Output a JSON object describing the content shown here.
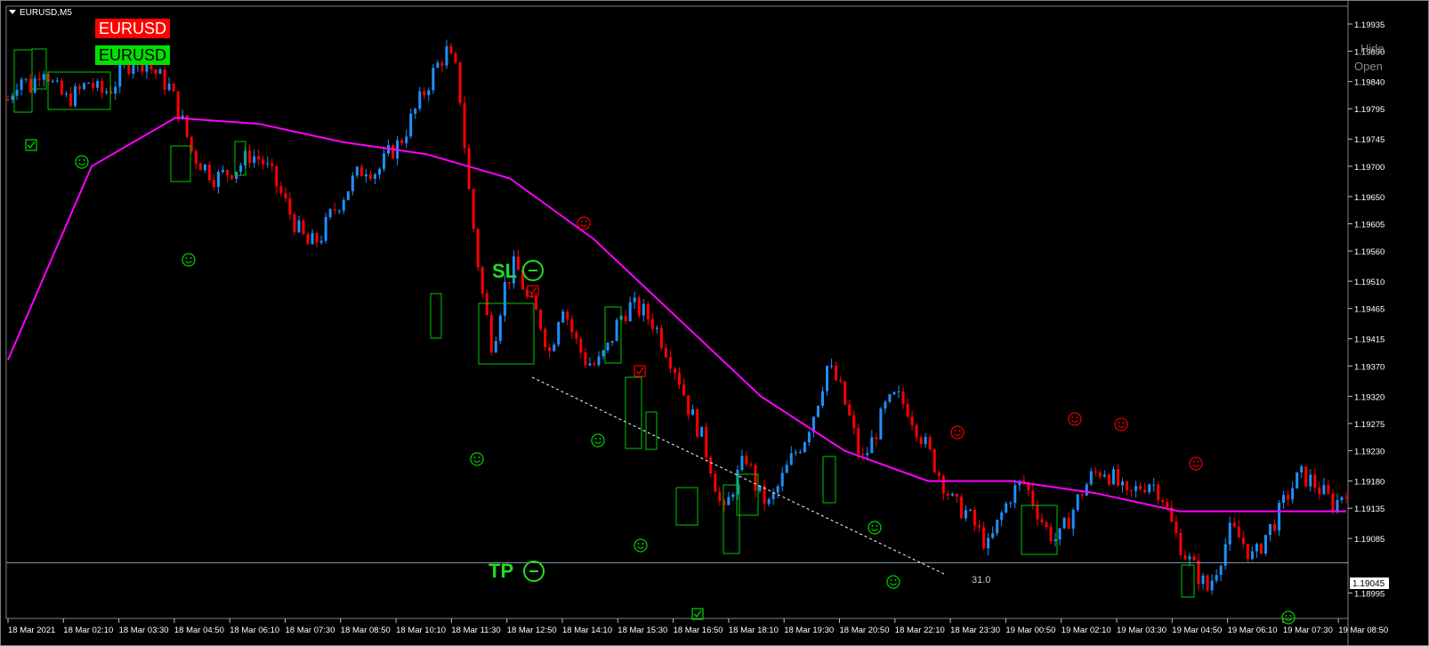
{
  "window": {
    "symbol_tf": "EURUSD,M5"
  },
  "overlay": {
    "tag_red": "EURUSD",
    "tag_green": "EURUSD",
    "hide": "Hide",
    "open": "Open",
    "sl_label": "SL",
    "tp_label": "TP",
    "measure": "31.0",
    "current_price": "1.19045",
    "colors": {
      "bull": "#1e90ff",
      "bear": "#ff0000",
      "ma": "#ff00ff",
      "box": "#00c800",
      "tag_red": "#ff0000",
      "tag_green": "#00e000",
      "smiley_good": "#00c800",
      "smiley_bad": "#e00000"
    }
  },
  "chart_data": {
    "type": "candlestick",
    "symbol": "EURUSD",
    "timeframe": "M5",
    "ylim": [
      1.18975,
      1.1996
    ],
    "y_ticks": [
      "1.19935",
      "1.19890",
      "1.19840",
      "1.19795",
      "1.19745",
      "1.19700",
      "1.19650",
      "1.19605",
      "1.19560",
      "1.19510",
      "1.19465",
      "1.19415",
      "1.19370",
      "1.19320",
      "1.19275",
      "1.19230",
      "1.19180",
      "1.19135",
      "1.19085",
      "1.19045",
      "1.18995"
    ],
    "x_ticks": [
      "18 Mar 2021",
      "18 Mar 02:10",
      "18 Mar 03:30",
      "18 Mar 04:50",
      "18 Mar 06:10",
      "18 Mar 07:30",
      "18 Mar 08:50",
      "18 Mar 10:10",
      "18 Mar 11:30",
      "18 Mar 12:50",
      "18 Mar 14:10",
      "18 Mar 15:30",
      "18 Mar 16:50",
      "18 Mar 18:10",
      "18 Mar 19:30",
      "18 Mar 20:50",
      "18 Mar 22:10",
      "18 Mar 23:30",
      "19 Mar 00:50",
      "19 Mar 02:10",
      "19 Mar 03:30",
      "19 Mar 04:50",
      "19 Mar 06:10",
      "19 Mar 07:30",
      "19 Mar 08:50"
    ],
    "close_path": [
      1.1981,
      1.1985,
      1.1983,
      1.1987,
      1.1983,
      1.1981,
      1.1982,
      1.1984,
      1.1982,
      1.1983,
      1.1986,
      1.1988,
      1.1987,
      1.1985,
      1.1983,
      1.1978,
      1.1972,
      1.197,
      1.1968,
      1.1969,
      1.197,
      1.1972,
      1.1971,
      1.1968,
      1.1964,
      1.196,
      1.1957,
      1.1958,
      1.1962,
      1.1965,
      1.1968,
      1.197,
      1.1969,
      1.1972,
      1.1974,
      1.1978,
      1.1982,
      1.1986,
      1.1989,
      1.1985,
      1.1965,
      1.195,
      1.194,
      1.195,
      1.1954,
      1.1948,
      1.1945,
      1.1939,
      1.1948,
      1.1942,
      1.1938,
      1.1937,
      1.194,
      1.1945,
      1.1947,
      1.1946,
      1.1944,
      1.194,
      1.1936,
      1.193,
      1.1926,
      1.192,
      1.1912,
      1.1918,
      1.1922,
      1.1916,
      1.1914,
      1.1918,
      1.1922,
      1.1925,
      1.193,
      1.1937,
      1.1934,
      1.1928,
      1.1921,
      1.1925,
      1.193,
      1.1932,
      1.193,
      1.1926,
      1.1922,
      1.1918,
      1.1914,
      1.1913,
      1.191,
      1.1907,
      1.1912,
      1.1916,
      1.1918,
      1.1914,
      1.191,
      1.1908,
      1.1912,
      1.1916,
      1.1919,
      1.192,
      1.1918,
      1.1915,
      1.1917,
      1.1918,
      1.1916,
      1.191,
      1.1906,
      1.1903,
      1.19,
      1.1905,
      1.191,
      1.1908,
      1.1905,
      1.1909,
      1.1912,
      1.1916,
      1.1919,
      1.1918,
      1.1916,
      1.1914,
      1.1917
    ],
    "moving_average": {
      "color": "magenta",
      "values": [
        1.1938,
        1.197,
        1.1978,
        1.1977,
        1.1974,
        1.1972,
        1.1968,
        1.1958,
        1.1945,
        1.1932,
        1.1923,
        1.1918,
        1.1918,
        1.1916,
        1.1913,
        1.1913,
        1.1913
      ]
    },
    "horizontal_line": 1.19045,
    "grid": false
  }
}
